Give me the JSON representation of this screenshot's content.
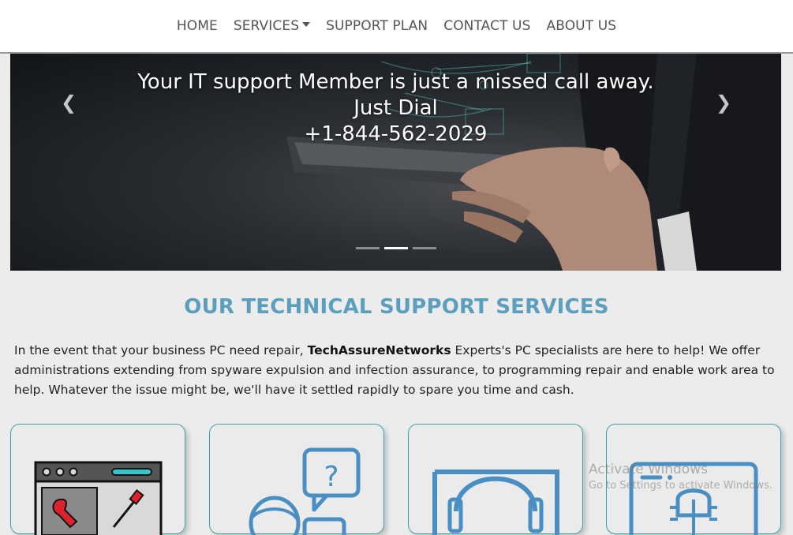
{
  "nav": {
    "items": [
      {
        "label": "HOME"
      },
      {
        "label": "SERVICES"
      },
      {
        "label": "SUPPORT PLAN"
      },
      {
        "label": "CONTACT US"
      },
      {
        "label": "ABOUT US"
      }
    ]
  },
  "carousel": {
    "line1": "Your IT support Member is just a missed call away.",
    "line2": "Just Dial",
    "phone": "+1-844-562-2029",
    "prev_icon": "chevron-left-icon",
    "next_icon": "chevron-right-icon",
    "slide_count": 3,
    "active_slide": 2
  },
  "services": {
    "title": "OUR TECHNICAL SUPPORT SERVICES",
    "intro_before": "In the event that your business PC need repair, ",
    "intro_brand": "TechAssureNetworks",
    "intro_after": " Experts's PC specialists are here to help! We offer administrations extending from spyware expulsion and infection assurance, to programming repair and enable work area to help. Whatever the issue might be, we'll have it settled rapidly to spare you time and cash.",
    "cards": [
      {
        "icon": "repair-tools-window-icon"
      },
      {
        "icon": "question-chat-user-icon"
      },
      {
        "icon": "headset-support-icon"
      },
      {
        "icon": "bug-window-icon"
      }
    ]
  },
  "colors": {
    "accent": "#5b9fbf",
    "card_border": "#3aa3a8",
    "icon_blue": "#4a8fc4",
    "icon_red": "#e0212b"
  },
  "watermark": {
    "line1": "Activate Windows",
    "line2": "Go to Settings to activate Windows."
  }
}
